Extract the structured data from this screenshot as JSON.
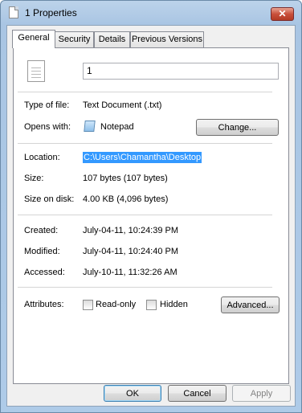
{
  "window": {
    "title": "1 Properties",
    "close_label": "✕"
  },
  "tabs": [
    {
      "label": "General"
    },
    {
      "label": "Security"
    },
    {
      "label": "Details"
    },
    {
      "label": "Previous Versions"
    }
  ],
  "general": {
    "file_name": "1",
    "type_label": "Type of file:",
    "type_value": "Text Document (.txt)",
    "opens_label": "Opens with:",
    "opens_value": "Notepad",
    "change_button": "Change...",
    "location_label": "Location:",
    "location_value": "C:\\Users\\Chamantha\\Desktop",
    "size_label": "Size:",
    "size_value": "107 bytes (107 bytes)",
    "size_disk_label": "Size on disk:",
    "size_disk_value": "4.00 KB (4,096 bytes)",
    "created_label": "Created:",
    "created_value": "July-04-11, 10:24:39 PM",
    "modified_label": "Modified:",
    "modified_value": "July-04-11, 10:24:40 PM",
    "accessed_label": "Accessed:",
    "accessed_value": "July-10-11, 11:32:26 AM",
    "attributes_label": "Attributes:",
    "readonly_label": "Read-only",
    "hidden_label": "Hidden",
    "advanced_button": "Advanced..."
  },
  "buttons": {
    "ok": "OK",
    "cancel": "Cancel",
    "apply": "Apply"
  },
  "icons": {
    "title": "document-icon",
    "file": "text-file-icon",
    "app": "notepad-icon"
  }
}
